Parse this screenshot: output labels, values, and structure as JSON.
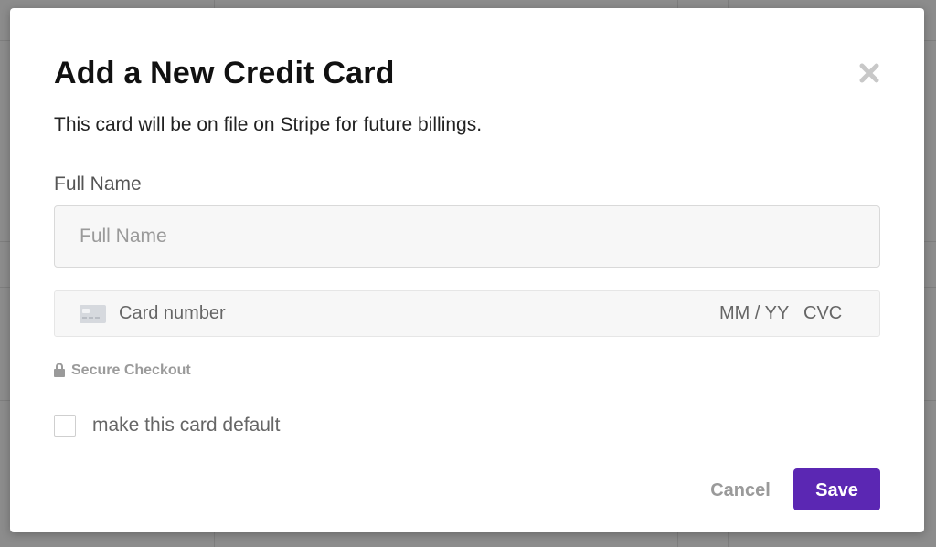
{
  "dialog": {
    "title": "Add a New Credit Card",
    "subtitle": "This card will be on file on Stripe for future billings.",
    "close_icon": "close-icon"
  },
  "form": {
    "full_name": {
      "label": "Full Name",
      "placeholder": "Full Name",
      "value": ""
    },
    "card": {
      "icon": "credit-card-icon",
      "number_placeholder": "Card number",
      "expiry_placeholder": "MM / YY",
      "cvc_placeholder": "CVC"
    },
    "secure": {
      "icon": "lock-icon",
      "text": "Secure Checkout"
    },
    "default_checkbox": {
      "label": "make this card default",
      "checked": false
    }
  },
  "actions": {
    "cancel_label": "Cancel",
    "save_label": "Save"
  },
  "colors": {
    "accent": "#5b27b3",
    "backdrop": "#8c8c8c",
    "muted_text": "#9a9a9a"
  }
}
